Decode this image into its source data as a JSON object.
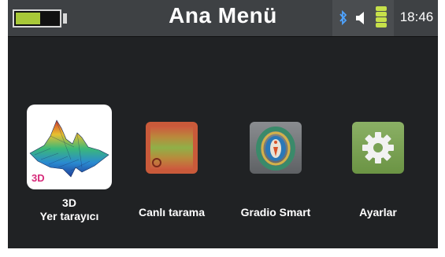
{
  "topbar": {
    "title": "Ana Menü",
    "battery_level": 0.6,
    "clock": "18:46",
    "icons": [
      "battery-icon",
      "bluetooth-icon",
      "speaker-icon",
      "signal-icon"
    ]
  },
  "apps": [
    {
      "label_line1": "3D",
      "label_line2": "Yer tarayıcı",
      "icon": "3d-terrain-icon",
      "badge": "3D"
    },
    {
      "label": "Canlı tarama",
      "icon": "live-scan-icon"
    },
    {
      "label": "Gradio Smart",
      "icon": "gradio-smart-icon"
    },
    {
      "label": "Ayarlar",
      "icon": "gear-icon"
    }
  ],
  "colors": {
    "background": "#202224",
    "topbar": "#3e4144",
    "battery": "#a8c838",
    "signal": "#c6e04a",
    "settings_tile": "#7aa256",
    "live_tile": "#c95a3a"
  }
}
